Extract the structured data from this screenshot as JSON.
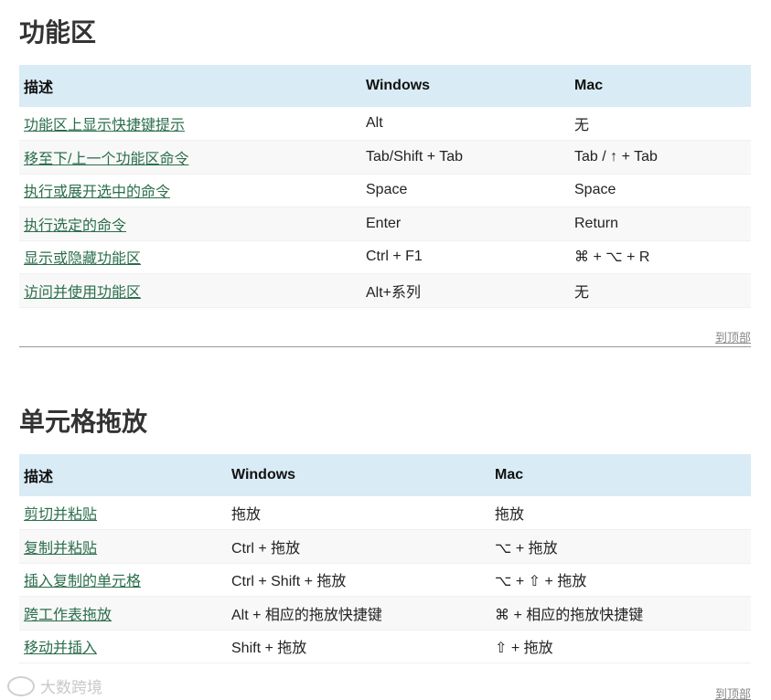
{
  "sections": [
    {
      "title": "功能区",
      "headers": [
        "描述",
        "Windows",
        "Mac"
      ],
      "rows": [
        [
          "功能区上显示快捷键提示",
          "Alt",
          "无"
        ],
        [
          "移至下/上一个功能区命令",
          "Tab/Shift + Tab",
          "Tab / ↑ + Tab"
        ],
        [
          "执行或展开选中的命令",
          "Space",
          "Space"
        ],
        [
          "执行选定的命令",
          "Enter",
          "Return"
        ],
        [
          "显示或隐藏功能区",
          "Ctrl + F1",
          "⌘ + ⌥ + R"
        ],
        [
          "访问并使用功能区",
          "Alt+系列",
          "无"
        ]
      ],
      "back_to_top": "到顶部"
    },
    {
      "title": "单元格拖放",
      "headers": [
        "描述",
        "Windows",
        "Mac"
      ],
      "rows": [
        [
          "剪切并粘贴",
          "拖放",
          "拖放"
        ],
        [
          "复制并粘贴",
          "Ctrl + 拖放",
          "⌥ + 拖放"
        ],
        [
          "插入复制的单元格",
          "Ctrl + Shift + 拖放",
          "⌥ + ⇧ + 拖放"
        ],
        [
          "跨工作表拖放",
          "Alt + 相应的拖放快捷键",
          "⌘ + 相应的拖放快捷键"
        ],
        [
          "移动并插入",
          "Shift + 拖放",
          "⇧ + 拖放"
        ]
      ],
      "back_to_top": "到顶部"
    }
  ],
  "watermark": "大数跨境",
  "colors": {
    "header_bg": "#d9ebf5",
    "link": "#2b6e4c",
    "row_alt": "#f8f8f8"
  }
}
